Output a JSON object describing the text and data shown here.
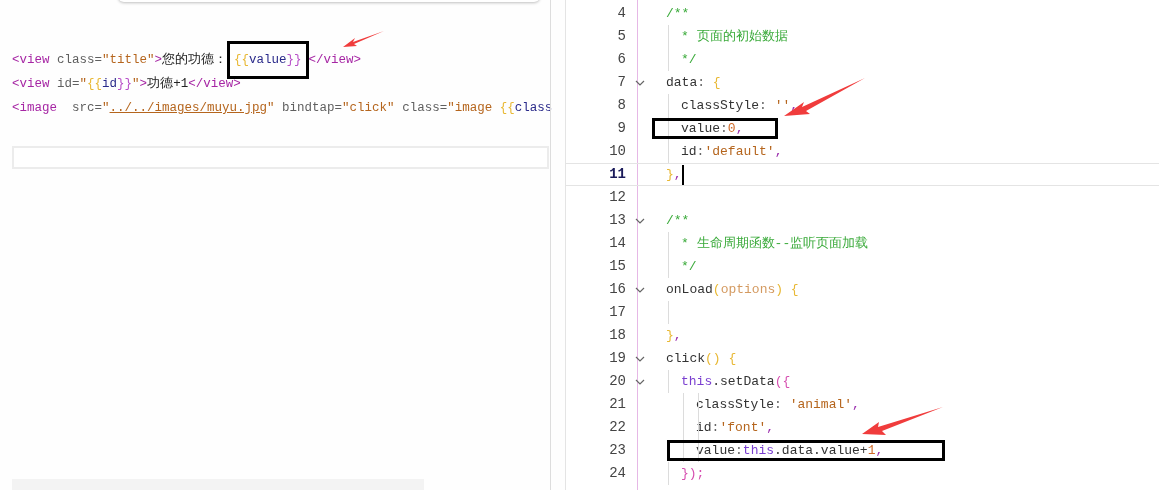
{
  "template_editor": {
    "lines": [
      {
        "tokens": [
          {
            "kind": "tag",
            "text": "<view"
          },
          {
            "kind": "attr",
            "text": " class="
          },
          {
            "kind": "string",
            "text": "\"title\""
          },
          {
            "kind": "tag",
            "text": ">"
          },
          {
            "kind": "text",
            "text": "您的功德："
          },
          {
            "kind": "box",
            "tokens": [
              {
                "kind": "brace",
                "text": "{{"
              },
              {
                "kind": "var",
                "text": "value"
              },
              {
                "kind": "brace2",
                "text": "}}"
              }
            ]
          },
          {
            "kind": "tag",
            "text": "</view>"
          }
        ]
      },
      {
        "tokens": [
          {
            "kind": "tag",
            "text": "<view"
          },
          {
            "kind": "attr",
            "text": " id="
          },
          {
            "kind": "string",
            "text": "\""
          },
          {
            "kind": "brace",
            "text": "{{"
          },
          {
            "kind": "var",
            "text": "id"
          },
          {
            "kind": "brace2",
            "text": "}}"
          },
          {
            "kind": "string",
            "text": "\""
          },
          {
            "kind": "tag",
            "text": ">"
          },
          {
            "kind": "text",
            "text": "功德+1"
          },
          {
            "kind": "tag",
            "text": "</view>"
          }
        ]
      },
      {
        "tokens": [
          {
            "kind": "tag",
            "text": "<image"
          },
          {
            "kind": "attr",
            "text": "  src="
          },
          {
            "kind": "string",
            "text": "\""
          },
          {
            "kind": "link",
            "text": "../../images/muyu.jpg"
          },
          {
            "kind": "string",
            "text": "\""
          },
          {
            "kind": "attr",
            "text": " bindtap="
          },
          {
            "kind": "string",
            "text": "\"click\""
          },
          {
            "kind": "attr",
            "text": " class="
          },
          {
            "kind": "string",
            "text": "\"image "
          },
          {
            "kind": "brace",
            "text": "{{"
          },
          {
            "kind": "var",
            "text": "class"
          }
        ]
      }
    ]
  },
  "script_editor": {
    "lines": [
      {
        "number": "4",
        "foldable": false,
        "current": false,
        "boxed": false,
        "tokens": [
          {
            "kind": "comment",
            "text": "/**"
          }
        ],
        "children": [
          {
            "number": "5",
            "foldable": false,
            "current": false,
            "boxed": false,
            "tokens": [
              {
                "kind": "comment",
                "text": "* 页面的初始数据"
              }
            ]
          },
          {
            "number": "6",
            "foldable": false,
            "current": false,
            "boxed": false,
            "tokens": [
              {
                "kind": "comment",
                "text": "*/"
              }
            ]
          }
        ]
      },
      {
        "number": "7",
        "foldable": true,
        "current": false,
        "boxed": false,
        "tokens": [
          {
            "kind": "key",
            "text": "data"
          },
          {
            "kind": "punct",
            "text": ": "
          },
          {
            "kind": "brace",
            "text": "{"
          }
        ],
        "children": [
          {
            "number": "8",
            "foldable": false,
            "current": false,
            "boxed": false,
            "tokens": [
              {
                "kind": "key",
                "text": "classStyle"
              },
              {
                "kind": "punct",
                "text": ": "
              },
              {
                "kind": "string",
                "text": "''"
              },
              {
                "kind": "comma",
                "text": ","
              }
            ]
          },
          {
            "number": "9",
            "foldable": false,
            "current": false,
            "boxed": true,
            "tokens": [
              {
                "kind": "key",
                "text": "value"
              },
              {
                "kind": "punct",
                "text": ":"
              },
              {
                "kind": "number",
                "text": "0"
              },
              {
                "kind": "comma",
                "text": ","
              }
            ]
          },
          {
            "number": "10",
            "foldable": false,
            "current": false,
            "boxed": false,
            "tokens": [
              {
                "kind": "key",
                "text": "id"
              },
              {
                "kind": "punct",
                "text": ":"
              },
              {
                "kind": "string",
                "text": "'default'"
              },
              {
                "kind": "comma",
                "text": ","
              }
            ]
          }
        ]
      },
      {
        "number": "11",
        "foldable": false,
        "current": true,
        "boxed": false,
        "tokens": [
          {
            "kind": "brace",
            "text": "}"
          },
          {
            "kind": "comma",
            "text": ","
          }
        ]
      },
      {
        "number": "12",
        "foldable": false,
        "current": false,
        "boxed": false
      },
      {
        "number": "13",
        "foldable": true,
        "current": false,
        "boxed": false,
        "tokens": [
          {
            "kind": "comment",
            "text": "/**"
          }
        ],
        "children": [
          {
            "number": "14",
            "foldable": false,
            "current": false,
            "boxed": false,
            "tokens": [
              {
                "kind": "comment",
                "text": "* 生命周期函数--监听页面加载"
              }
            ]
          },
          {
            "number": "15",
            "foldable": false,
            "current": false,
            "boxed": false,
            "tokens": [
              {
                "kind": "comment",
                "text": "*/"
              }
            ]
          }
        ]
      },
      {
        "number": "16",
        "foldable": true,
        "current": false,
        "boxed": false,
        "tokens": [
          {
            "kind": "key",
            "text": "onLoad"
          },
          {
            "kind": "brace",
            "text": "("
          },
          {
            "kind": "param",
            "text": "options"
          },
          {
            "kind": "brace",
            "text": ") {"
          }
        ],
        "children": [
          {
            "number": "17",
            "foldable": false,
            "current": false,
            "boxed": false
          }
        ]
      },
      {
        "number": "18",
        "foldable": false,
        "current": false,
        "boxed": false,
        "tokens": [
          {
            "kind": "brace",
            "text": "}"
          },
          {
            "kind": "comma",
            "text": ","
          }
        ]
      },
      {
        "number": "19",
        "foldable": true,
        "current": false,
        "boxed": false,
        "tokens": [
          {
            "kind": "key",
            "text": "click"
          },
          {
            "kind": "brace",
            "text": "() {"
          }
        ],
        "children": [
          {
            "number": "20",
            "foldable": true,
            "current": false,
            "boxed": false,
            "tokens": [
              {
                "kind": "this",
                "text": "this"
              },
              {
                "kind": "key",
                "text": ".setData"
              },
              {
                "kind": "paren",
                "text": "({"
              }
            ],
            "children": [
              {
                "number": "21",
                "foldable": false,
                "current": false,
                "boxed": false,
                "tokens": [
                  {
                    "kind": "key",
                    "text": "classStyle"
                  },
                  {
                    "kind": "punct",
                    "text": ": "
                  },
                  {
                    "kind": "string",
                    "text": "'animal'"
                  },
                  {
                    "kind": "comma",
                    "text": ","
                  }
                ]
              },
              {
                "number": "22",
                "foldable": false,
                "current": false,
                "boxed": false,
                "tokens": [
                  {
                    "kind": "key",
                    "text": "id"
                  },
                  {
                    "kind": "punct",
                    "text": ":"
                  },
                  {
                    "kind": "string",
                    "text": "'font'"
                  },
                  {
                    "kind": "comma",
                    "text": ","
                  }
                ]
              },
              {
                "number": "23",
                "foldable": false,
                "current": false,
                "boxed": true,
                "tokens": [
                  {
                    "kind": "key",
                    "text": "value"
                  },
                  {
                    "kind": "punct",
                    "text": ":"
                  },
                  {
                    "kind": "this",
                    "text": "this"
                  },
                  {
                    "kind": "key",
                    "text": ".data.value+"
                  },
                  {
                    "kind": "number",
                    "text": "1"
                  },
                  {
                    "kind": "comma",
                    "text": ","
                  }
                ]
              }
            ]
          },
          {
            "number": "24",
            "foldable": false,
            "current": false,
            "boxed": false,
            "tokens": [
              {
                "kind": "paren",
                "text": "});"
              }
            ]
          }
        ]
      }
    ]
  }
}
